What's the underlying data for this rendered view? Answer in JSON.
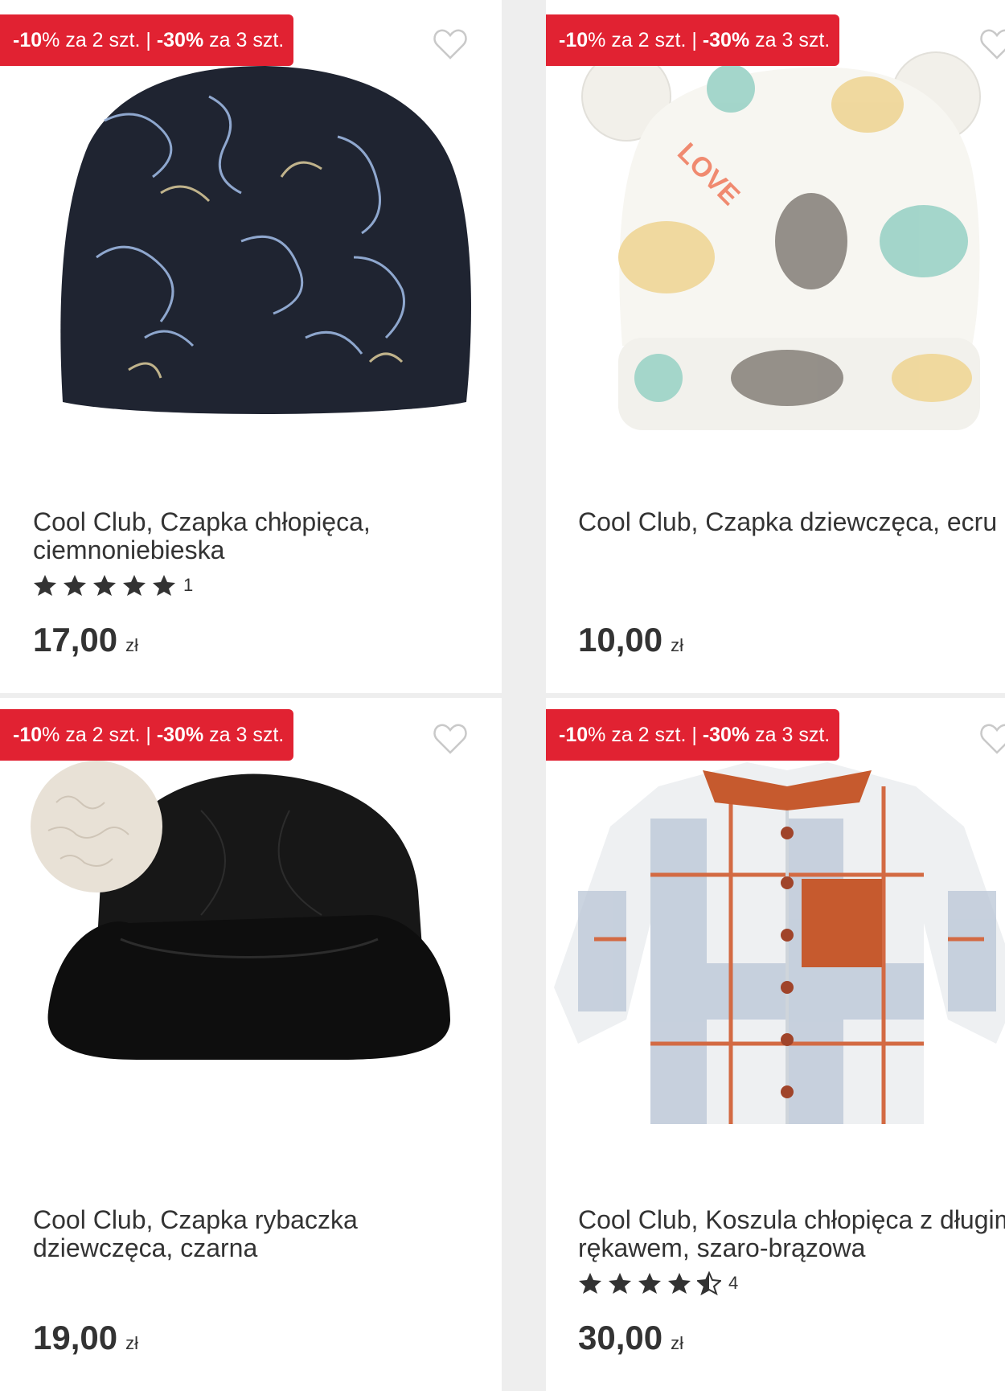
{
  "promo": {
    "a": "-10",
    "pct": "%",
    "b": " za 2 szt. | ",
    "c": "-30%",
    "d": " za 3 szt."
  },
  "currency": "zł",
  "products": [
    {
      "title": "Cool Club, Czapka chłopięca, ciemnoniebieska",
      "price": "17,00",
      "rating": 5,
      "reviews": "1",
      "favorite_icon": "heart-outline-icon"
    },
    {
      "title": "Cool Club, Czapka dziewczęca, ecru",
      "price": "10,00",
      "favorite_icon": "heart-outline-icon"
    },
    {
      "title": "Cool Club, Czapka rybaczka dziewczęca, czarna",
      "price": "19,00",
      "favorite_icon": "heart-outline-icon"
    },
    {
      "title": "Cool Club, Koszula chłopięca z długim rękawem, szaro-brązowa",
      "price": "30,00",
      "rating": 4.5,
      "reviews": "4",
      "favorite_icon": "heart-outline-icon"
    }
  ],
  "colors": {
    "promo_bg": "#e12232",
    "star": "#333333"
  }
}
